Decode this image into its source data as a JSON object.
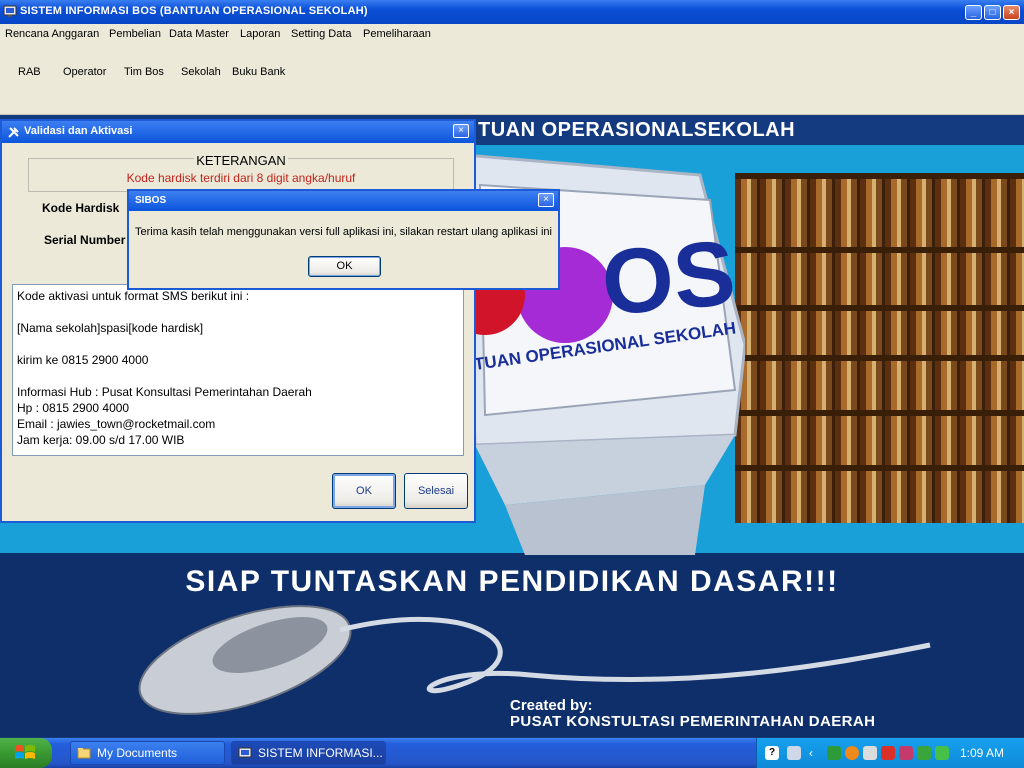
{
  "main_window": {
    "title": "SISTEM INFORMASI BOS (BANTUAN OPERASIONAL SEKOLAH)",
    "controls": {
      "minimize": "_",
      "maximize": "□",
      "close": "×"
    }
  },
  "menu": [
    "Rencana Anggaran",
    "Pembelian",
    "Data Master",
    "Laporan",
    "Setting Data",
    "Pemeliharaan"
  ],
  "toolbar": [
    "RAB",
    "Operator",
    "Tim Bos",
    "Sekolah",
    "Buku Bank"
  ],
  "background": {
    "banner_title": "TUAN OPERASIONALSEKOLAH",
    "screen_logo": "OS",
    "screen_subtitle": "TUAN OPERASIONAL SEKOLAH",
    "slogan": "SIAP TUNTASKAN PENDIDIKAN DASAR!!!",
    "created_by": "Created by:",
    "creator": "PUSAT KONSTULTASI PEMERINTAHAN DAERAH"
  },
  "validasi_dialog": {
    "title": "Validasi dan Aktivasi",
    "close": "×",
    "keterangan_title": "KETERANGAN",
    "keterangan_text": "Kode hardisk terdiri dari 8 digit angka/huruf",
    "kode_hardisk_label": "Kode Hardisk",
    "serial_number_label": "Serial Number",
    "info_text": "Kode aktivasi untuk format SMS berikut ini :\n\n[Nama sekolah]spasi[kode hardisk]\n\nkirim ke 0815 2900 4000\n\nInformasi Hub : Pusat Konsultasi Pemerintahan Daerah\nHp : 0815 2900 4000\nEmail : jawies_town@rocketmail.com\nJam kerja: 09.00 s/d 17.00 WIB",
    "ok_button": "OK",
    "selesai_button": "Selesai"
  },
  "sibos_dialog": {
    "title": "SIBOS",
    "close": "×",
    "message": "Terima kasih telah menggunakan versi full aplikasi ini, silakan restart ulang aplikasi ini",
    "ok_button": "OK"
  },
  "taskbar": {
    "tasks": [
      "My Documents",
      "SISTEM INFORMASI..."
    ],
    "clock": "1:09 AM"
  }
}
